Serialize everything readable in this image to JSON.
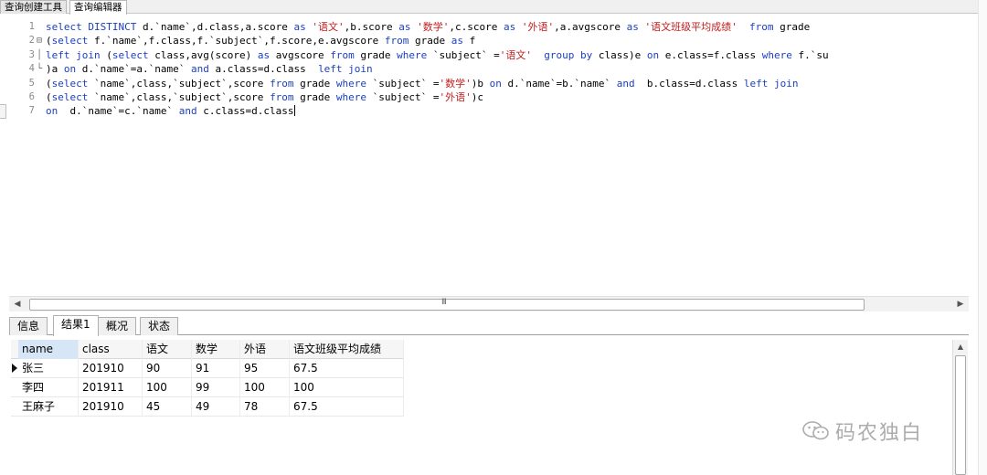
{
  "top_tabs": [
    {
      "label": "查询创建工具",
      "active": false
    },
    {
      "label": "查询编辑器",
      "active": true
    }
  ],
  "editor": {
    "lines": [
      {
        "number": "1",
        "fold": "",
        "tokens": [
          {
            "t": "select DISTINCT",
            "c": "kw"
          },
          {
            "t": " d.`name`,d.class,a.score ",
            "c": ""
          },
          {
            "t": "as",
            "c": "kw"
          },
          {
            "t": " ",
            "c": ""
          },
          {
            "t": "'语文'",
            "c": "str"
          },
          {
            "t": ",b.score ",
            "c": ""
          },
          {
            "t": "as",
            "c": "kw"
          },
          {
            "t": " ",
            "c": ""
          },
          {
            "t": "'数学'",
            "c": "str"
          },
          {
            "t": ",c.score ",
            "c": ""
          },
          {
            "t": "as",
            "c": "kw"
          },
          {
            "t": " ",
            "c": ""
          },
          {
            "t": "'外语'",
            "c": "str"
          },
          {
            "t": ",a.avgscore ",
            "c": ""
          },
          {
            "t": "as",
            "c": "kw"
          },
          {
            "t": " ",
            "c": ""
          },
          {
            "t": "'语文班级平均成绩'",
            "c": "str"
          },
          {
            "t": "  ",
            "c": ""
          },
          {
            "t": "from",
            "c": "kw"
          },
          {
            "t": " grade",
            "c": ""
          }
        ]
      },
      {
        "number": "2",
        "fold": "⊟",
        "tokens": [
          {
            "t": "(",
            "c": ""
          },
          {
            "t": "select",
            "c": "kw"
          },
          {
            "t": " f.`name`,f.class,f.`subject`,f.score,e.avgscore ",
            "c": ""
          },
          {
            "t": "from",
            "c": "kw"
          },
          {
            "t": " grade ",
            "c": ""
          },
          {
            "t": "as",
            "c": "kw"
          },
          {
            "t": " f",
            "c": ""
          }
        ]
      },
      {
        "number": "3",
        "fold": "│",
        "tokens": [
          {
            "t": "left join",
            "c": "kw"
          },
          {
            "t": " (",
            "c": ""
          },
          {
            "t": "select",
            "c": "kw"
          },
          {
            "t": " class,avg(score) ",
            "c": ""
          },
          {
            "t": "as",
            "c": "kw"
          },
          {
            "t": " avgscore ",
            "c": ""
          },
          {
            "t": "from",
            "c": "kw"
          },
          {
            "t": " grade ",
            "c": ""
          },
          {
            "t": "where",
            "c": "kw"
          },
          {
            "t": " `subject` =",
            "c": ""
          },
          {
            "t": "'语文'",
            "c": "str"
          },
          {
            "t": "  ",
            "c": ""
          },
          {
            "t": "group by",
            "c": "kw"
          },
          {
            "t": " class)e ",
            "c": ""
          },
          {
            "t": "on",
            "c": "kw"
          },
          {
            "t": " e.class=f.class ",
            "c": ""
          },
          {
            "t": "where",
            "c": "kw"
          },
          {
            "t": " f.`su",
            "c": ""
          }
        ]
      },
      {
        "number": "4",
        "fold": "└",
        "tokens": [
          {
            "t": ")a ",
            "c": ""
          },
          {
            "t": "on",
            "c": "kw"
          },
          {
            "t": " d.`name`=a.`name` ",
            "c": ""
          },
          {
            "t": "and",
            "c": "kw"
          },
          {
            "t": " a.class=d.class  ",
            "c": ""
          },
          {
            "t": "left join",
            "c": "kw"
          }
        ]
      },
      {
        "number": "5",
        "fold": "",
        "tokens": [
          {
            "t": "(",
            "c": ""
          },
          {
            "t": "select",
            "c": "kw"
          },
          {
            "t": " `name`,class,`subject`,score ",
            "c": ""
          },
          {
            "t": "from",
            "c": "kw"
          },
          {
            "t": " grade ",
            "c": ""
          },
          {
            "t": "where",
            "c": "kw"
          },
          {
            "t": " `subject` =",
            "c": ""
          },
          {
            "t": "'数学'",
            "c": "str"
          },
          {
            "t": ")b ",
            "c": ""
          },
          {
            "t": "on",
            "c": "kw"
          },
          {
            "t": " d.`name`=b.`name` ",
            "c": ""
          },
          {
            "t": "and",
            "c": "kw"
          },
          {
            "t": "  b.class=d.class ",
            "c": ""
          },
          {
            "t": "left join",
            "c": "kw"
          }
        ]
      },
      {
        "number": "6",
        "fold": "",
        "tokens": [
          {
            "t": "(",
            "c": ""
          },
          {
            "t": "select",
            "c": "kw"
          },
          {
            "t": " `name`,class,`subject`,score ",
            "c": ""
          },
          {
            "t": "from",
            "c": "kw"
          },
          {
            "t": " grade ",
            "c": ""
          },
          {
            "t": "where",
            "c": "kw"
          },
          {
            "t": " `subject` =",
            "c": ""
          },
          {
            "t": "'外语'",
            "c": "str"
          },
          {
            "t": ")c",
            "c": ""
          }
        ]
      },
      {
        "number": "7",
        "fold": "",
        "tokens": [
          {
            "t": "on",
            "c": "kw"
          },
          {
            "t": "  d.`name`=c.`name` ",
            "c": ""
          },
          {
            "t": "and",
            "c": "kw"
          },
          {
            "t": " c.class=d.class",
            "c": ""
          }
        ]
      }
    ]
  },
  "scrollbar": {
    "grip": "III"
  },
  "result_tabs": [
    {
      "label": "信息",
      "active": false
    },
    {
      "label": "结果1",
      "active": true
    },
    {
      "label": "概况",
      "active": false
    },
    {
      "label": "状态",
      "active": false
    }
  ],
  "grid": {
    "columns": [
      "name",
      "class",
      "语文",
      "数学",
      "外语",
      "语文班级平均成绩"
    ],
    "rows": [
      [
        "张三",
        "201910",
        "90",
        "91",
        "95",
        "67.5"
      ],
      [
        "李四",
        "201911",
        "100",
        "99",
        "100",
        "100"
      ],
      [
        "王麻子",
        "201910",
        "45",
        "49",
        "78",
        "67.5"
      ]
    ],
    "current_row": 0
  },
  "watermark": {
    "text": "码农独白"
  },
  "colors": {
    "keyword": "#1b3fbf",
    "string": "#c02020",
    "selected_column": "#d6e6f7"
  }
}
